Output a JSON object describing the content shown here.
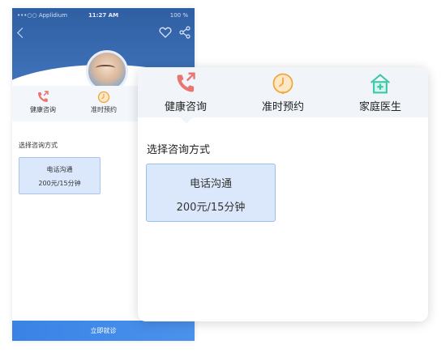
{
  "status_bar": {
    "carrier": "•••○○ Applidium",
    "time": "11:27 AM",
    "battery": "100 %"
  },
  "nav": {
    "back_icon": "chevron-left-icon",
    "favorite_icon": "heart-icon",
    "share_icon": "share-icon"
  },
  "tabs": [
    {
      "label": "健康咨询",
      "icon": "phone-call-icon",
      "color": "#e8756f"
    },
    {
      "label": "准时预约",
      "icon": "clock-icon",
      "color": "#f0a63a"
    },
    {
      "label": "家庭医生",
      "icon": "house-plus-icon",
      "color": "#3cc7a6"
    }
  ],
  "consult": {
    "section_title": "选择咨询方式",
    "option": {
      "title": "电话沟通",
      "price": "200元/15分钟"
    }
  },
  "submit_label": "立即就诊",
  "colors": {
    "header_blue": "#3a6ab0",
    "accent_blue": "#3a83e6",
    "option_bg": "#dbe8fb"
  }
}
